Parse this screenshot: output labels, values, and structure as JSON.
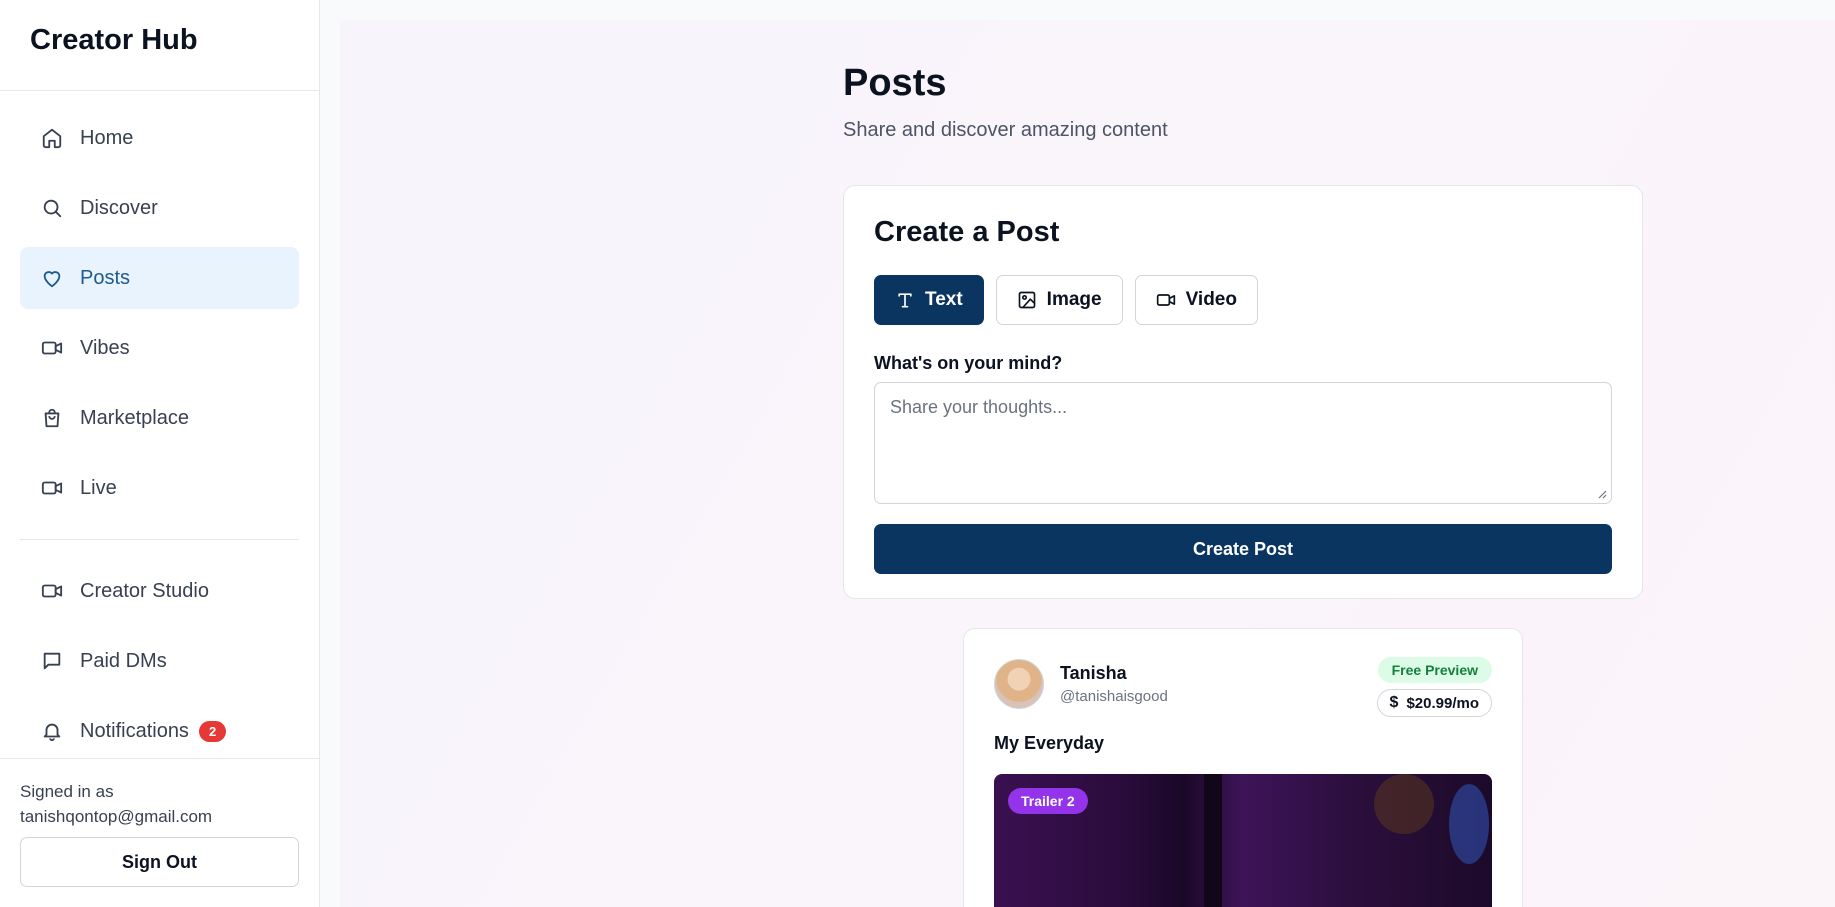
{
  "app": {
    "brand": "Creator Hub"
  },
  "sidebar": {
    "items": [
      {
        "label": "Home",
        "icon": "home-icon"
      },
      {
        "label": "Discover",
        "icon": "search-icon"
      },
      {
        "label": "Posts",
        "icon": "heart-icon",
        "active": true
      },
      {
        "label": "Vibes",
        "icon": "video-icon"
      },
      {
        "label": "Marketplace",
        "icon": "shopping-bag-icon"
      },
      {
        "label": "Live",
        "icon": "video-icon"
      }
    ],
    "secondary": [
      {
        "label": "Creator Studio",
        "icon": "video-icon"
      },
      {
        "label": "Paid DMs",
        "icon": "message-icon"
      },
      {
        "label": "Notifications",
        "icon": "bell-icon",
        "badge": "2"
      }
    ],
    "footer": {
      "signed_in_label": "Signed in as",
      "email": "tanishqontop@gmail.com",
      "sign_out": "Sign Out"
    }
  },
  "header": {
    "title": "Posts",
    "subtitle": "Share and discover amazing content"
  },
  "create_post": {
    "title": "Create a Post",
    "tabs": [
      {
        "label": "Text",
        "icon": "text-type-icon",
        "active": true
      },
      {
        "label": "Image",
        "icon": "image-icon"
      },
      {
        "label": "Video",
        "icon": "video-icon"
      }
    ],
    "field_label": "What's on your mind?",
    "placeholder": "Share your thoughts...",
    "submit": "Create Post"
  },
  "post": {
    "author": "Tanisha",
    "handle": "@tanishaisgood",
    "badge": "Free Preview",
    "price_symbol": "$",
    "price": "$20.99/mo",
    "title": "My Everyday",
    "media_tag": "Trailer 2"
  },
  "colors": {
    "primary": "#0a3560",
    "active_nav_bg": "#e8f3fd",
    "badge_red": "#e53935",
    "free_green": "#15803d",
    "trailer_purple": "#9333ea"
  }
}
